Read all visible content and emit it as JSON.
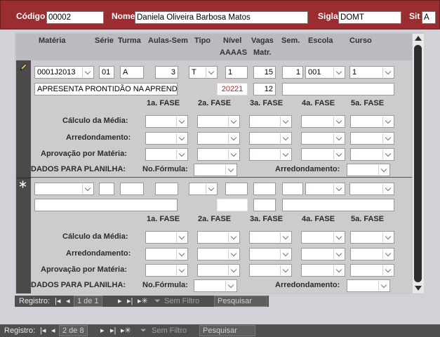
{
  "header": {
    "codigo_label": "Código",
    "codigo_value": "00002",
    "nome_label": "Nome",
    "nome_value": "Daniela Oliveira Barbosa Matos",
    "sigla_label": "Sigla",
    "sigla_value": "DOMT",
    "sit_label": "Sit",
    "sit_value": "A"
  },
  "columns": {
    "materia": "Matéria",
    "serie": "Série",
    "turma": "Turma",
    "aulas_sem": "Aulas-Sem",
    "tipo": "Tipo",
    "nivel": "Nível",
    "aaaas": "AAAAS",
    "vagas": "Vagas",
    "matr": "Matr.",
    "sem": "Sem.",
    "escola": "Escola",
    "curso": "Curso"
  },
  "record1": {
    "materia": "0001J2013",
    "serie": "01",
    "turma": "A",
    "aulas_sem": "3",
    "tipo": "T",
    "nivel": "1",
    "vagas": "15",
    "sem": "1",
    "escola": "001",
    "curso": "1",
    "descricao": "APRESENTA PRONTIDÃO NA APREND",
    "aaaas": "20221",
    "matr": "12"
  },
  "labels": {
    "fase1": "1a. FASE",
    "fase2": "2a. FASE",
    "fase3": "3a. FASE",
    "fase4": "4a. FASE",
    "fase5": "5a. FASE",
    "calculo_media": "Cálculo da Média:",
    "arredondamento": "Arredondamento:",
    "aprovacao": "Aprovação por Matéria:",
    "dados_planilha": "DADOS PARA PLANILHA:",
    "no_formula": "No.Fórmula:",
    "arredondamento2": "Arredondamento:"
  },
  "subform_nav": {
    "label": "Registro:",
    "position": "1 de 1",
    "filter": "Sem Filtro",
    "search": "Pesquisar"
  },
  "main_nav": {
    "label": "Registro:",
    "position": "2 de 8",
    "filter": "Sem Filtro",
    "search": "Pesquisar"
  },
  "icons": {
    "record_selector": "pencil-icon",
    "new_record": "asterisk-icon",
    "filter": "funnel-icon"
  }
}
